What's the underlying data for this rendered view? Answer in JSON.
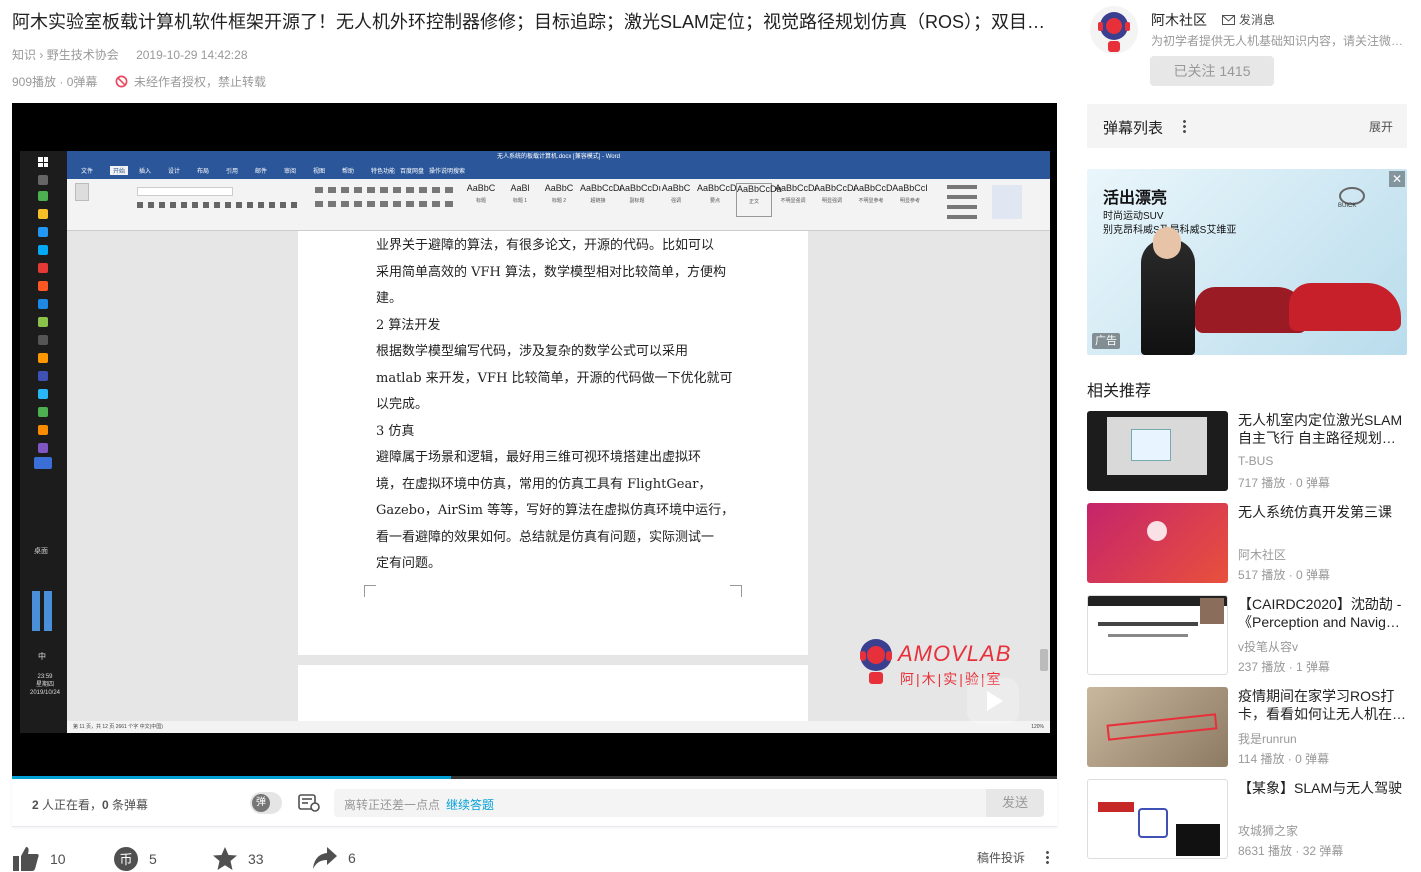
{
  "video": {
    "title": "阿木实验室板载计算机软件框架开源了！无人机外环控制器修修；目标追踪；激光SLAM定位；视觉路径规划仿真（ROS）；双目…",
    "breadcrumb": [
      "知识",
      "野生技术协会"
    ],
    "breadcrumb_sep": "›",
    "datetime": "2019-10-29 14:42:28",
    "plays": "909播放",
    "danmaku_count": "0弹幕",
    "stats_sep": " · ",
    "copyright": "未经作者授权，禁止转载",
    "progress": 0.42
  },
  "screen": {
    "word_title": "无人系统的板载计算机.docx [兼容模式] - Word",
    "word_tabs": [
      "文件",
      "开始",
      "插入",
      "设计",
      "布局",
      "引用",
      "邮件",
      "审阅",
      "视图",
      "帮助",
      "特色功能",
      "百度网盘",
      "操作说明搜索"
    ],
    "styles": [
      {
        "sample": "AaBbC",
        "name": "标题"
      },
      {
        "sample": "AaBl",
        "name": "标题 1"
      },
      {
        "sample": "AaBbC",
        "name": "标题 2"
      },
      {
        "sample": "AaBbCcDı",
        "name": "超链接"
      },
      {
        "sample": "AaBbCcDı",
        "name": "副标题"
      },
      {
        "sample": "AaBbC",
        "name": "强调"
      },
      {
        "sample": "AaBbCcD",
        "name": "要点"
      },
      {
        "sample": "AaBbCcDa",
        "name": "正文"
      },
      {
        "sample": "AaBbCcDı",
        "name": "不明显强调"
      },
      {
        "sample": "AaBbCcDı",
        "name": "明显强调"
      },
      {
        "sample": "AaBbCcD",
        "name": "不明显参考"
      },
      {
        "sample": "AaBbCcI",
        "name": "明显参考"
      }
    ],
    "doc_lines": [
      "业界关于避障的算法，有很多论文，开源的代码。比如可以",
      "采用简单高效的 VFH 算法，数学模型相对比较简单，方便构",
      "建。",
      "2  算法开发",
      "根据数学模型编写代码，涉及复杂的数学公式可以采用",
      "matlab 来开发，VFH 比较简单，开源的代码做一下优化就可",
      "以完成。",
      "3  仿真",
      "避障属于场景和逻辑，最好用三维可视环境搭建出虚拟环",
      "境，在虚拟环境中仿真，常用的仿真工具有  FlightGear，",
      "Gazebo，AirSim 等等，写好的算法在虚拟仿真环境中运行，",
      "看一看避障的效果如何。总结就是仿真有问题，实际测试一",
      "定有问题。"
    ],
    "status_left": "第 11 页，共 12 页    2661 个字    中文(中国)",
    "zoom": "120%",
    "taskbar_label": "桌面",
    "ime": "中",
    "clock_time": "23:59",
    "clock_day": "星期四",
    "clock_date": "2019/10/24",
    "watermark_en": "AMOVLAB",
    "watermark_cn": "阿|木|实|验|室"
  },
  "danmaku_bar": {
    "watching": "2",
    "watching_suffix": " 人正在看，",
    "count": "0",
    "count_suffix": " 条弹幕",
    "toggle_label": "弹",
    "placeholder": "离转正还差一点点",
    "continue": "继续答题",
    "send": "发送"
  },
  "actions": [
    {
      "icon": "like-icon",
      "count": "10"
    },
    {
      "icon": "coin-icon",
      "count": "5"
    },
    {
      "icon": "star-icon",
      "count": "33"
    },
    {
      "icon": "share-icon",
      "count": "6"
    }
  ],
  "report": "稿件投诉",
  "uploader": {
    "name": "阿木社区",
    "message": "发消息",
    "desc": "为初学者提供无人机基础知识内容，请关注微…",
    "follow": "已关注 1415"
  },
  "danmaku_list": {
    "title": "弹幕列表",
    "expand": "展开"
  },
  "ad": {
    "headline": "活出漂亮",
    "line1": "时尚运动SUV",
    "line2": "别克昂科威S及昂科威S艾维亚",
    "brand": "BUICK",
    "tag": "广告"
  },
  "related_title": "相关推荐",
  "related": [
    {
      "title": "无人机室内定位激光SLAM自主飞行 自主路径规划…",
      "up": "T-BUS",
      "stats": "717 播放 · 0 弹幕"
    },
    {
      "title": "无人系统仿真开发第三课",
      "up": "阿木社区",
      "stats": "517 播放 · 0 弹幕"
    },
    {
      "title": "【CAIRDC2020】沈劭劼 - 《Perception and Navig…",
      "up": "v投笔从容v",
      "stats": "237 播放 · 1 弹幕"
    },
    {
      "title": "疫情期间在家学习ROS打卡，看看如何让无人机在…",
      "up": "我是runrun",
      "stats": "114 播放 · 0 弹幕"
    },
    {
      "title": "【某象】SLAM与无人驾驶",
      "up": "攻城狮之家",
      "stats": "8631 播放 · 32 弹幕"
    }
  ],
  "colors": {
    "accent": "#00a1d6",
    "word_blue": "#2b579a",
    "amov_red": "#e8303b"
  }
}
